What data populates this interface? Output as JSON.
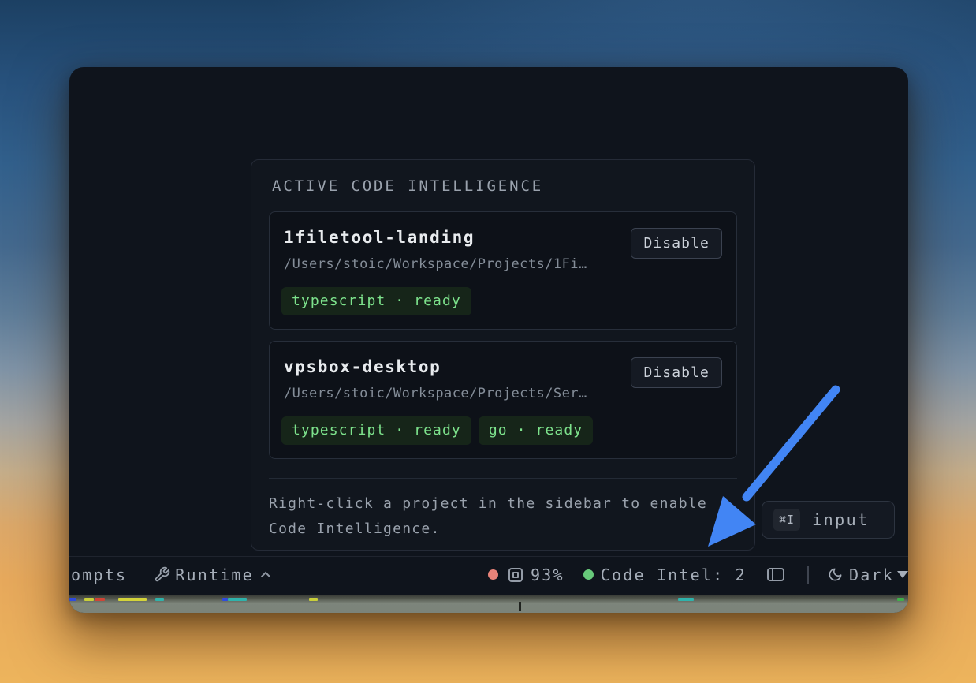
{
  "panel": {
    "title": "ACTIVE CODE INTELLIGENCE",
    "projects": [
      {
        "name": "1filetool-landing",
        "path": "/Users/stoic/Workspace/Projects/1Fi…",
        "action": "Disable",
        "badges": [
          "typescript · ready"
        ]
      },
      {
        "name": "vpsbox-desktop",
        "path": "/Users/stoic/Workspace/Projects/Ser…",
        "action": "Disable",
        "badges": [
          "typescript · ready",
          "go · ready"
        ]
      }
    ],
    "hint_line1": "Right-click a project in the sidebar to enable",
    "hint_line2": "Code Intelligence."
  },
  "shortcut": {
    "keys": "⌘I",
    "label": "input"
  },
  "statusbar": {
    "left_truncated_label": "ompts",
    "runtime_label": "Runtime",
    "context_percent": "93%",
    "code_intel_label": "Code Intel: 2",
    "theme_label": "Dark"
  },
  "colors": {
    "arrow_blue": "#4285f4",
    "badge_green_text": "#7de28c",
    "badge_green_bg": "#162519",
    "status_red_dot": "#e98379",
    "status_green_dot": "#67c97a"
  }
}
